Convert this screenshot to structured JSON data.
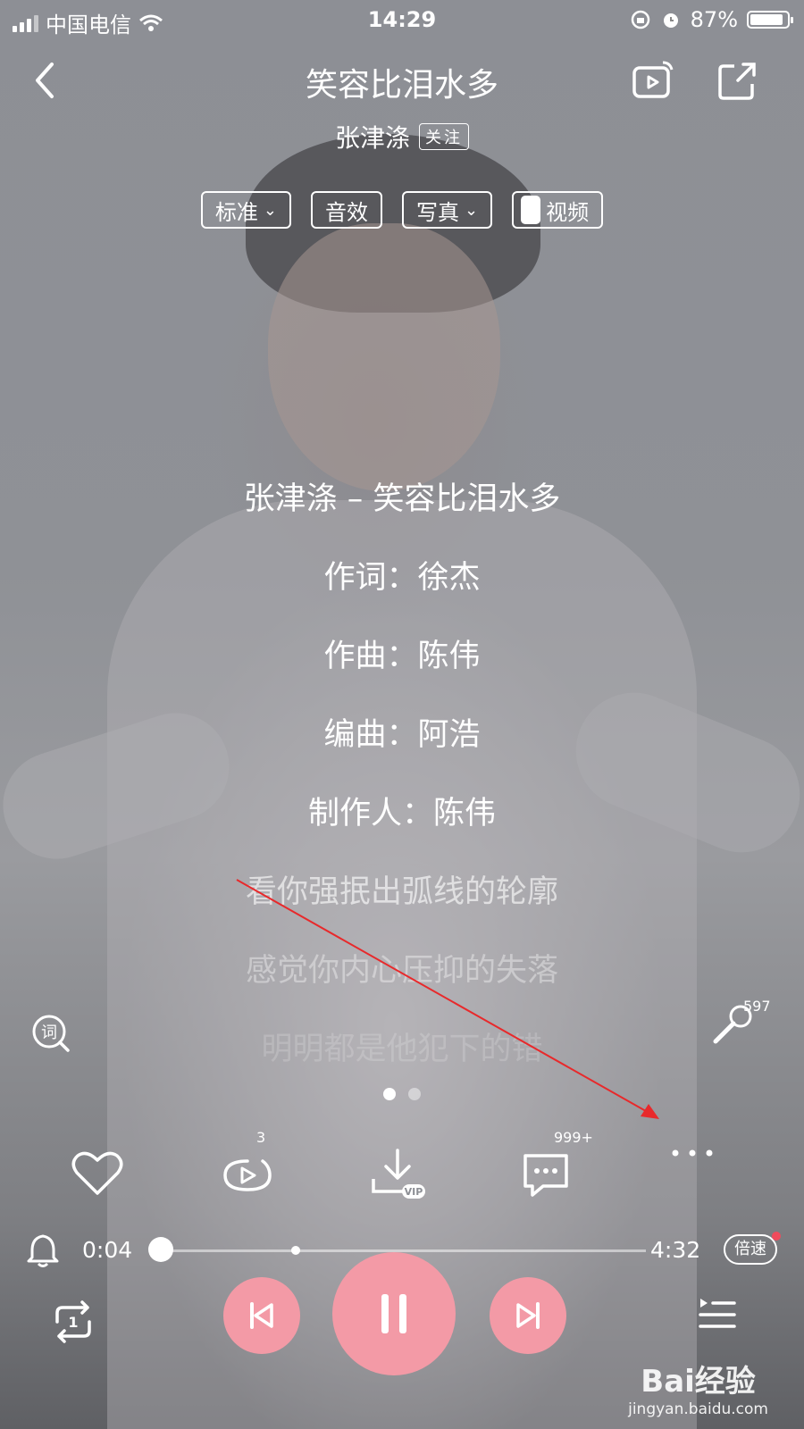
{
  "status_bar": {
    "carrier": "中国电信",
    "time": "14:29",
    "battery": "87%"
  },
  "header": {
    "title": "笑容比泪水多",
    "artist": "张津涤",
    "follow_label": "关注"
  },
  "options": [
    {
      "label": "标准",
      "has_dropdown": true
    },
    {
      "label": "音效",
      "has_dropdown": false
    },
    {
      "label": "写真",
      "has_dropdown": true
    },
    {
      "label": "视频",
      "toggle": true
    }
  ],
  "lyrics": [
    {
      "text": "张津涤 – 笑容比泪水多"
    },
    {
      "text": "作词：徐杰"
    },
    {
      "text": "作曲：陈伟"
    },
    {
      "text": "编曲：阿浩"
    },
    {
      "text": "制作人：陈伟"
    },
    {
      "text": "看你强抿出弧线的轮廓"
    },
    {
      "text": "感觉你内心压抑的失落"
    },
    {
      "text": "明明都是他犯下的错"
    }
  ],
  "side": {
    "karaoke_count": "597"
  },
  "actions": {
    "mv_count": "3",
    "comment_count": "999+",
    "download_tag": "VIP"
  },
  "playback": {
    "current_time": "0:04",
    "total_time": "4:32",
    "progress": 0.015,
    "speed_label": "倍速",
    "repeat_label": "1"
  },
  "watermark": {
    "brand": "Bai经验",
    "url": "jingyan.baidu.com"
  },
  "colors": {
    "accent": "#f39aa6",
    "badge_red": "#f04b5c"
  }
}
